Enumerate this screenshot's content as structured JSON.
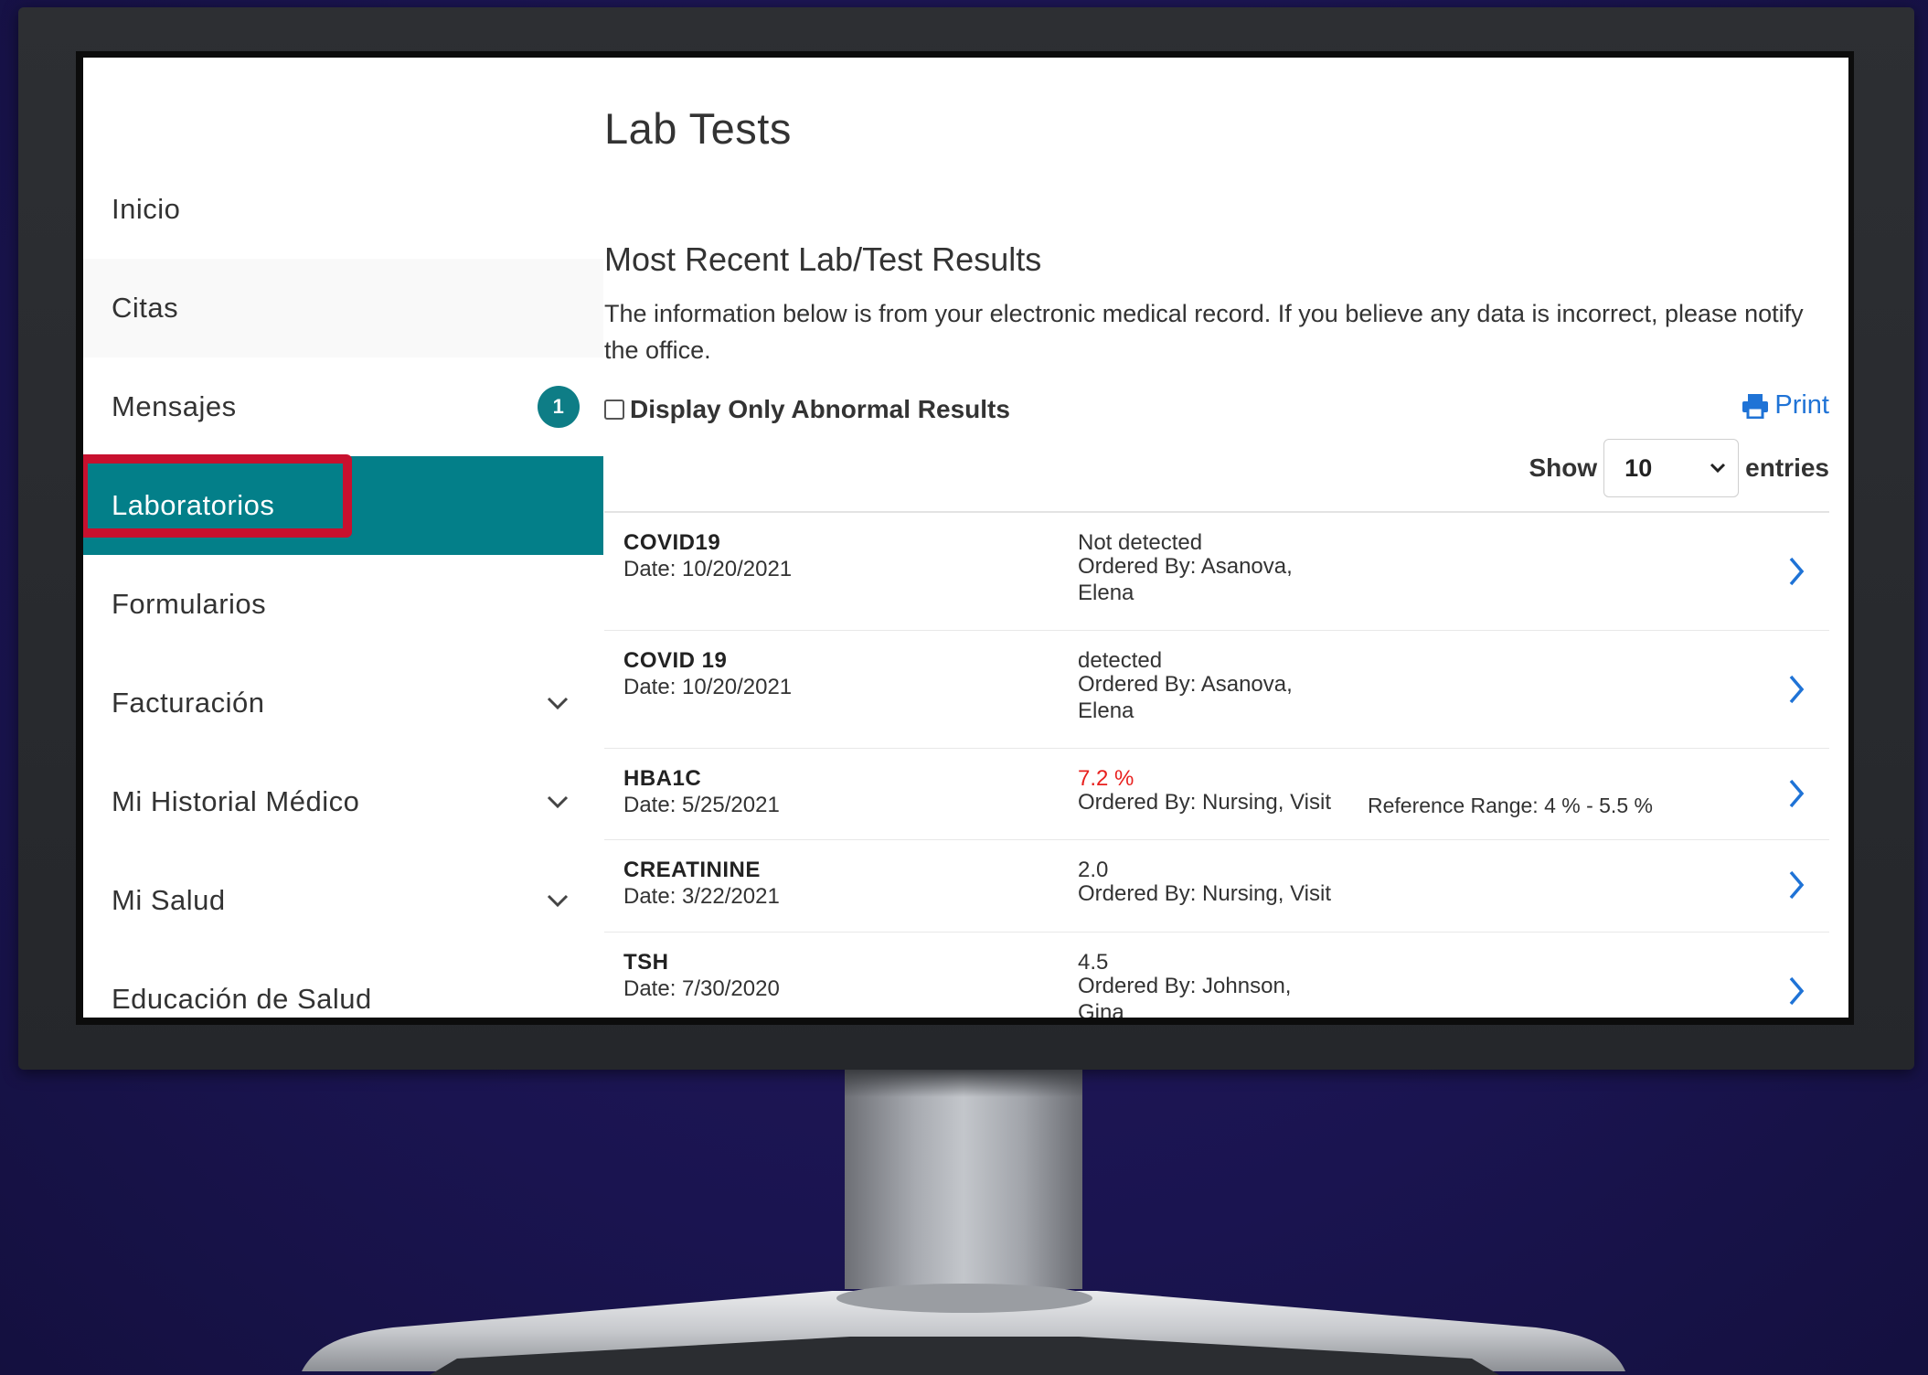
{
  "sidebar": {
    "items": [
      {
        "label": "Inicio"
      },
      {
        "label": "Citas"
      },
      {
        "label": "Mensajes",
        "badge": "1"
      },
      {
        "label": "Laboratorios"
      },
      {
        "label": "Formularios"
      },
      {
        "label": "Facturación"
      },
      {
        "label": "Mi Historial Médico"
      },
      {
        "label": "Mi Salud"
      },
      {
        "label": "Educación de Salud"
      }
    ]
  },
  "main": {
    "title": "Lab Tests",
    "section_title": "Most Recent Lab/Test Results",
    "intro": "The information below is from your electronic medical record. If you believe any data is incorrect, please notify the office.",
    "filter_label": "Display Only Abnormal Results",
    "print_label": "Print",
    "show_label": "Show",
    "entries_value": "10",
    "entries_label": "entries",
    "results": [
      {
        "name": "COVID19",
        "date": "Date: 10/20/2021",
        "result": "Not detected",
        "ordered": "Ordered By: Asanova, Elena",
        "reference": ""
      },
      {
        "name": "COVID 19",
        "date": "Date: 10/20/2021",
        "result": "detected",
        "ordered": "Ordered By: Asanova, Elena",
        "reference": ""
      },
      {
        "name": "HBA1C",
        "date": "Date: 5/25/2021",
        "result": "7.2 %",
        "ordered": "Ordered By: Nursing, Visit",
        "reference": "Reference Range: 4 % - 5.5 %",
        "abnormal": true
      },
      {
        "name": "CREATININE",
        "date": "Date: 3/22/2021",
        "result": "2.0",
        "ordered": "Ordered By: Nursing, Visit",
        "reference": ""
      },
      {
        "name": "TSH",
        "date": "Date: 7/30/2020",
        "result": "4.5",
        "ordered": "Ordered By: Johnson, Gina",
        "reference": ""
      }
    ]
  },
  "colors": {
    "accent_teal": "#037f89",
    "highlight_red": "#c8102e",
    "abnormal_red": "#e8201e",
    "link_blue": "#1f73d6",
    "background": "#1a1450"
  },
  "icons": [
    "chevron-down-icon",
    "printer-icon",
    "chevron-right-icon"
  ]
}
